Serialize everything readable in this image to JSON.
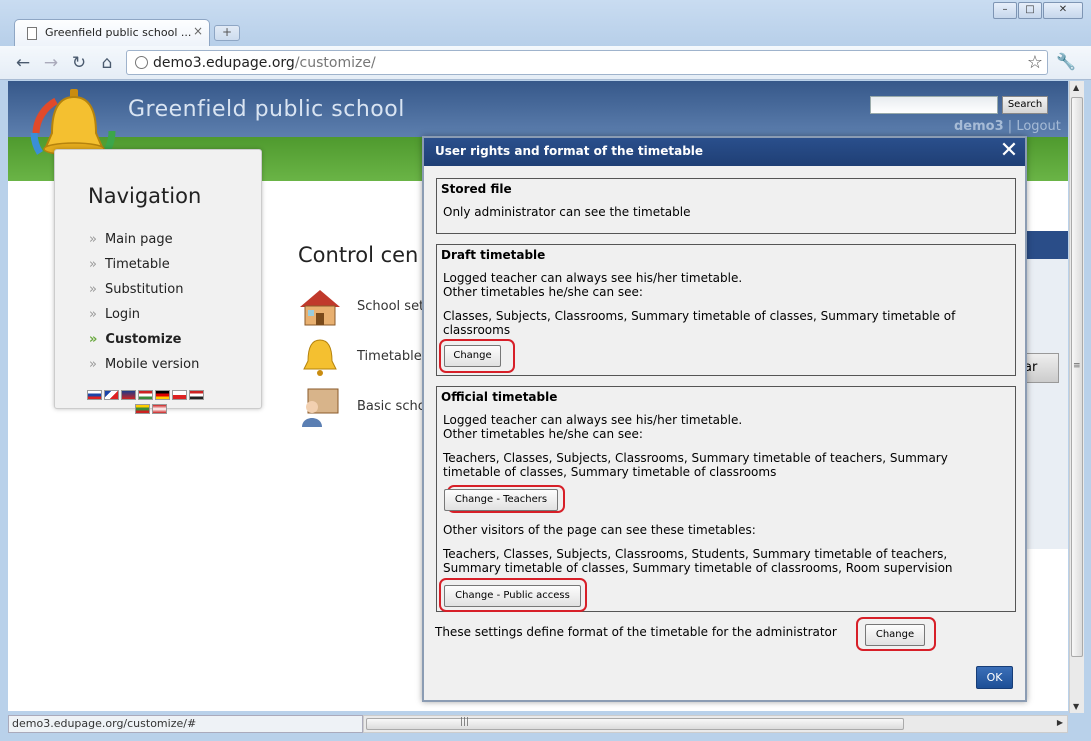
{
  "browser": {
    "tab_title": "Greenfield public school ...",
    "tab_close": "×",
    "new_tab": "+",
    "url_host": "demo3.edupage.org",
    "url_path": "/customize/",
    "status_url": "demo3.edupage.org/customize/#"
  },
  "site": {
    "title": "Greenfield public school",
    "search_button": "Search",
    "user": "demo3",
    "separator": " | ",
    "logout": "Logout"
  },
  "navigation": {
    "heading": "Navigation",
    "items": [
      {
        "label": "Main page"
      },
      {
        "label": "Timetable"
      },
      {
        "label": "Substitution"
      },
      {
        "label": "Login"
      },
      {
        "label": "Customize"
      },
      {
        "label": "Mobile version"
      }
    ]
  },
  "control_center": {
    "title": "Control cen",
    "items": [
      {
        "label": "School set"
      },
      {
        "label": "Timetable"
      },
      {
        "label": "Basic scho"
      }
    ],
    "right_tab": "ar"
  },
  "dialog": {
    "title": "User rights and format of the timetable",
    "close": "✕",
    "stored": {
      "heading": "Stored file",
      "text": "Only administrator can see the timetable"
    },
    "draft": {
      "heading": "Draft timetable",
      "line1": "Logged teacher can always see his/her timetable.",
      "line2": "Other timetables he/she can see:",
      "list": "Classes, Subjects, Classrooms, Summary timetable of classes, Summary timetable of classrooms",
      "button": "Change"
    },
    "official": {
      "heading": "Official timetable",
      "line1": "Logged teacher can always see his/her timetable.",
      "line2": "Other timetables he/she can see:",
      "list": "Teachers, Classes, Subjects, Classrooms, Summary timetable of teachers, Summary timetable of classes, Summary timetable of classrooms",
      "teachers_button": "Change - Teachers",
      "visitors_text": "Other visitors of the page can see these timetables:",
      "visitors_list": "Teachers, Classes, Subjects, Classrooms, Students, Summary timetable of teachers, Summary timetable of classes, Summary timetable of classrooms, Room supervision",
      "public_button": "Change - Public access"
    },
    "footer_text": "These settings define format of the timetable for the administrator",
    "footer_button": "Change",
    "ok": "OK"
  },
  "colors": {
    "header_blue": "#36588a",
    "green_bar": "#5aa536",
    "dialog_header": "#23467f",
    "highlight_ring": "#d71f28",
    "ok_button": "#2a5ea8"
  }
}
